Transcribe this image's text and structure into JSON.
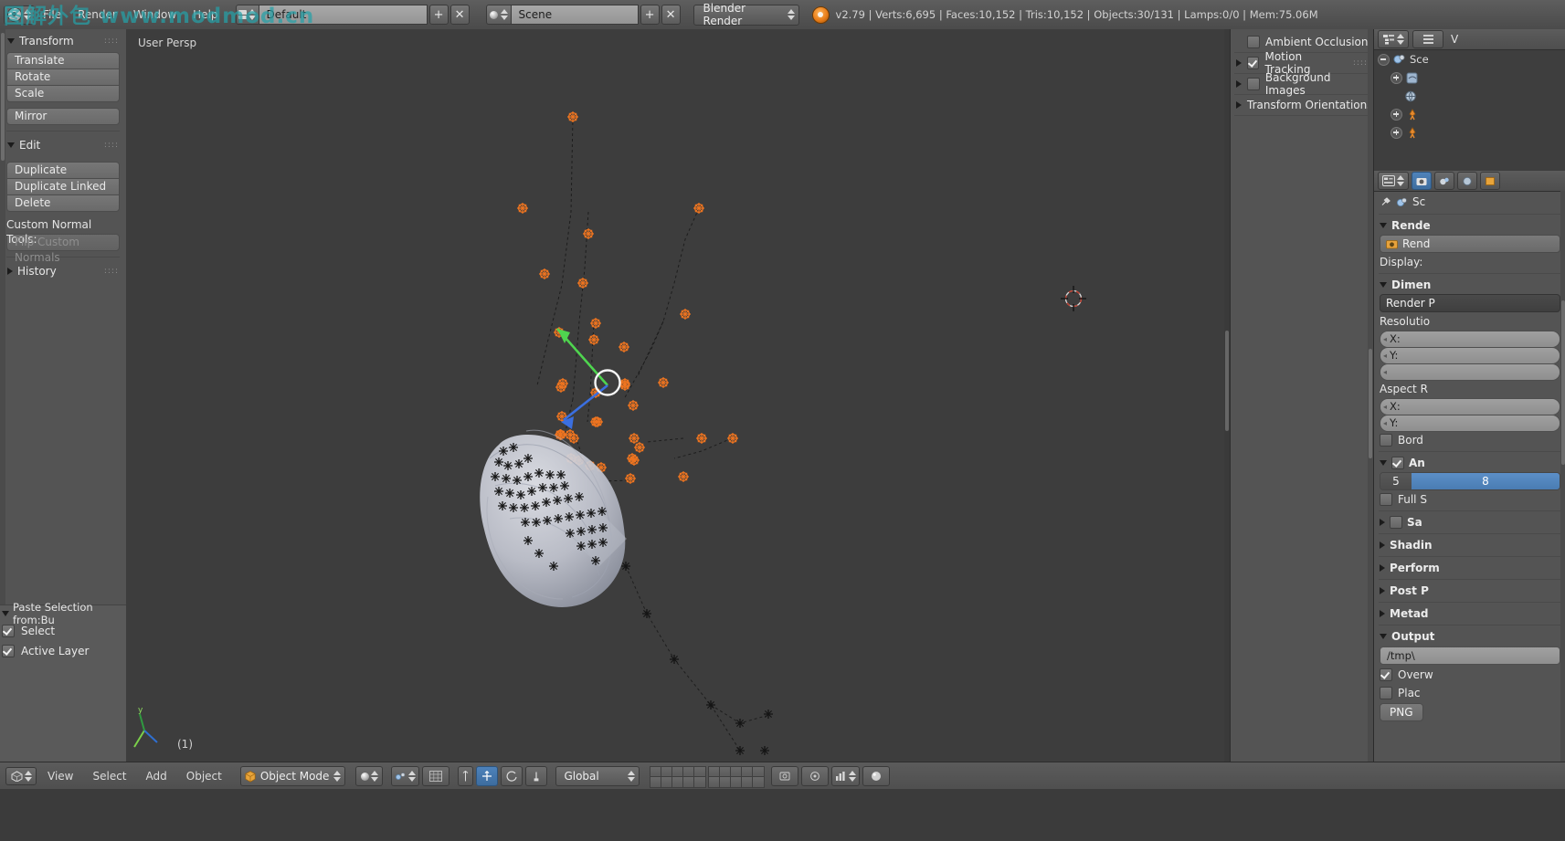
{
  "watermark": "图解外包  www.modmod.cn",
  "topbar": {
    "menus": [
      "File",
      "Render",
      "Window",
      "Help"
    ],
    "screen_layout": "Default",
    "scene_name": "Scene",
    "render_engine": "Blender Render",
    "status": "v2.79 | Verts:6,695 | Faces:10,152 | Tris:10,152 | Objects:30/131 | Lamps:0/0 | Mem:75.06M",
    "version": "v2.79",
    "verts": "Verts:6,695",
    "faces": "Faces:10,152",
    "tris": "Tris:10,152",
    "objects": "Objects:30/131",
    "lamps": "Lamps:0/0",
    "memory": "Mem:75.06M",
    "plus_label": "+",
    "x_label": "✕"
  },
  "toolshelf": {
    "transform": {
      "title": "Transform",
      "buttons": [
        "Translate",
        "Rotate",
        "Scale"
      ],
      "mirror": "Mirror"
    },
    "edit": {
      "title": "Edit",
      "buttons": [
        "Duplicate",
        "Duplicate Linked",
        "Delete"
      ],
      "custom_normal_label": "Custom Normal Tools:",
      "flip_custom_normals": "Flip Custom Normals"
    },
    "history": {
      "title": "History"
    },
    "operator_panel": {
      "title": "Paste Selection from:Bu",
      "options": [
        {
          "label": "Select",
          "checked": true
        },
        {
          "label": "Active Layer",
          "checked": true
        }
      ]
    }
  },
  "viewport": {
    "perspective_label": "User Persp",
    "frame_label": "(1)"
  },
  "npanel": {
    "items": [
      {
        "label": "Ambient Occlusion",
        "type": "checkbox",
        "checked": false,
        "expandable": false
      },
      {
        "label": "Motion Tracking",
        "type": "checkbox",
        "checked": true,
        "expandable": true,
        "grip": true
      },
      {
        "label": "Background Images",
        "type": "checkbox",
        "checked": false,
        "expandable": true
      },
      {
        "label": "Transform Orientations",
        "type": "section",
        "expandable": true
      }
    ]
  },
  "outliner": {
    "view_label": "V",
    "scene_label": "Sce",
    "rows": [
      "Sce"
    ]
  },
  "properties": {
    "breadcrumb": "Sc",
    "render_section": "Rende",
    "render_button": "Rend",
    "display_label": "Display:",
    "dimensions_section": "Dimen",
    "render_presets": "Render P",
    "resolution_label": "Resolutio",
    "resolution_x": "X:",
    "resolution_y": "Y:",
    "aspect_label": "Aspect R",
    "aspect_x": "X:",
    "aspect_y": "Y:",
    "border_label": "Bord",
    "antialiasing_label": "An",
    "aa_samples_left": "5",
    "aa_samples_right": "8",
    "full_sample_label": "Full S",
    "sampled_label": "Sa",
    "shading_label": "Shadin",
    "performance_label": "Perform",
    "post_processing_label": "Post P",
    "metadata_label": "Metad",
    "output_section": "Output",
    "output_path": "/tmp\\",
    "overwrite_label": "Overw",
    "placeholders_label": "Plac",
    "file_format": "PNG"
  },
  "bottombar": {
    "menus": [
      "View",
      "Select",
      "Add",
      "Object"
    ],
    "mode": "Object Mode",
    "transform_orientation": "Global"
  },
  "colors": {
    "accent_blue": "#4d82bb",
    "selection_orange": "#ef7520",
    "axis_green": "#4fd54f",
    "axis_blue": "#3b6fe0",
    "watermark_teal": "#25a1a8",
    "panel_bg": "#545454",
    "viewport_bg": "#3d3d3d"
  }
}
